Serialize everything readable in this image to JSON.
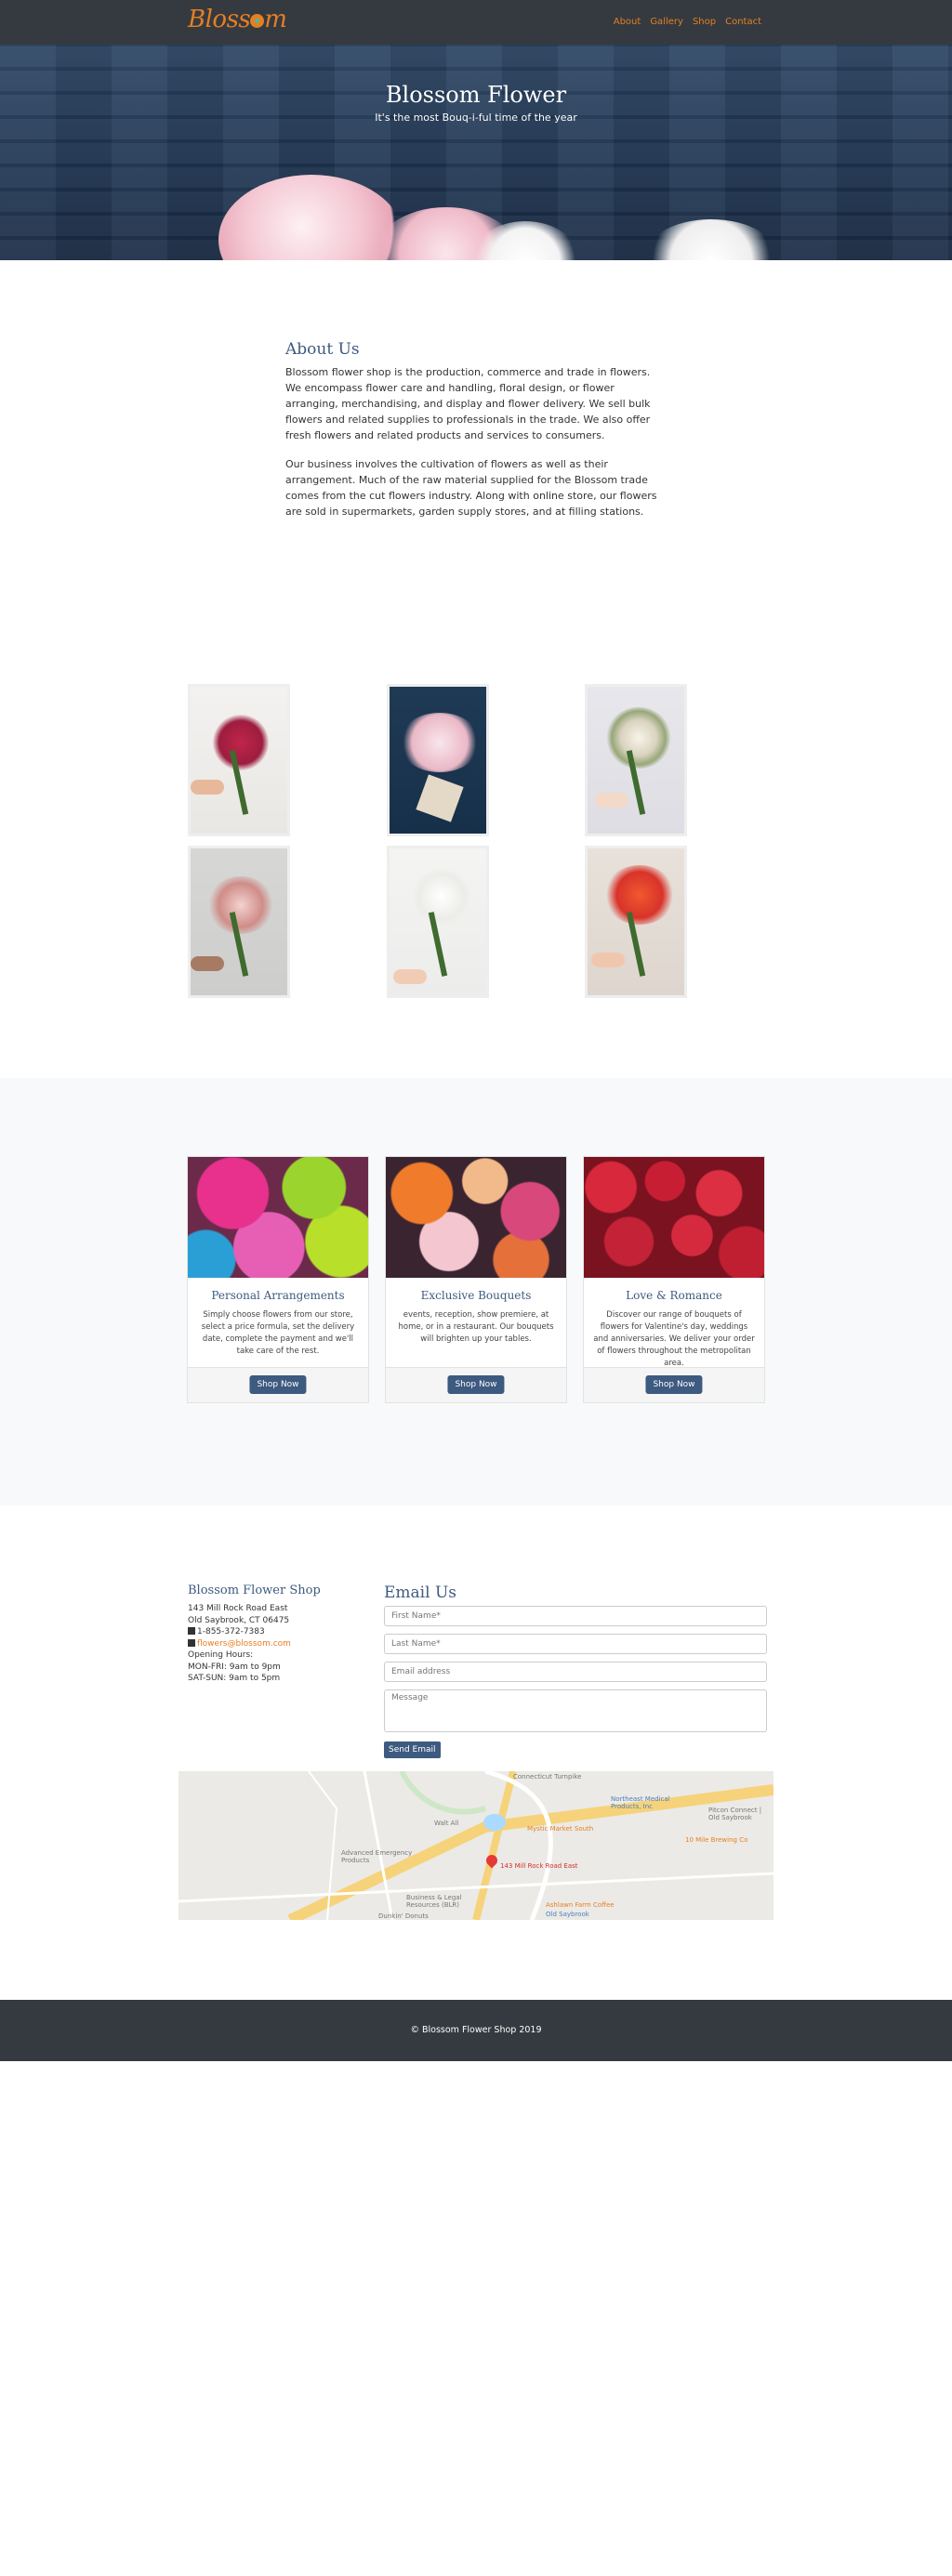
{
  "nav": {
    "brand": "Blossom",
    "links": [
      "About",
      "Gallery",
      "Shop",
      "Contact"
    ],
    "accent": "#e67e22",
    "background": "#343a40"
  },
  "hero": {
    "title": "Blossom Flower",
    "subtitle": "It's the most Bouq-i-ful time of the year"
  },
  "about": {
    "heading": "About Us",
    "paragraphs": [
      "Blossom flower shop is the production, commerce and trade in flowers. We encompass flower care and handling, floral design, or flower arranging, merchandising, and display and flower delivery. We sell bulk flowers and related supplies to professionals in the trade. We also offer fresh flowers and related products and services to consumers.",
      "Our business involves the cultivation of flowers as well as their arrangement. Much of the raw material supplied for the Blossom trade comes from the cut flowers industry. Along with online store, our flowers are sold in supermarkets, garden supply stores, and at filling stations."
    ]
  },
  "products": [
    {
      "title": "Personal Arrangements",
      "text": "Simply choose flowers from our store, select a price formula, set the delivery date, complete the payment and we'll take care of the rest.",
      "button": "Shop Now"
    },
    {
      "title": "Exclusive Bouquets",
      "text": "events, reception, show premiere, at home, or in a restaurant. Our bouquets will brighten up your tables.",
      "button": "Shop Now"
    },
    {
      "title": "Love & Romance",
      "text": "Discover our range of bouquets of flowers for Valentine's day, weddings and anniversaries. We deliver your order of flowers throughout the metropolitan area.",
      "button": "Shop Now"
    }
  ],
  "shop": {
    "heading": "Blossom Flower Shop",
    "address1": "143 Mill Rock Road East",
    "address2": "Old Saybrook, CT 06475",
    "phone": "1-855-372-7383",
    "email": "flowers@blossom.com",
    "hours_label": "Opening Hours:",
    "hours_weekday": "MON-FRI: 9am to 9pm",
    "hours_weekend": "SAT-SUN: 9am to 5pm"
  },
  "contact": {
    "heading": "Email Us",
    "first_name_placeholder": "First Name*",
    "last_name_placeholder": "Last Name*",
    "email_placeholder": "Email address",
    "message_placeholder": "Message",
    "send_label": "Send Email"
  },
  "map": {
    "marker_label": "143 Mill Rock Road East",
    "labels": [
      "Walt All",
      "Advanced Emergency Products",
      "Mystic Market South",
      "Northeast Medical Products, Inc",
      "10 Mile Brewing Co",
      "Pitcon Connect | Old Saybrook",
      "Business & Legal Resources (BLR)",
      "Ashlawn Farm Coffee",
      "Old Saybrook",
      "Dunkin' Donuts",
      "Connecticut Turnpike"
    ]
  },
  "footer": {
    "copyright": "© Blossom Flower Shop 2019"
  }
}
